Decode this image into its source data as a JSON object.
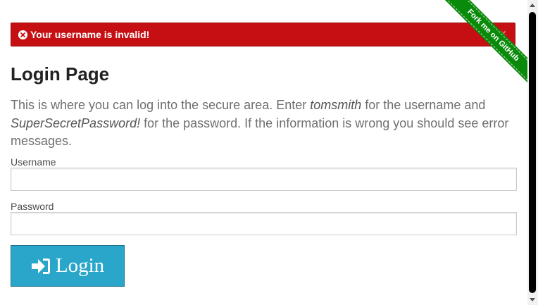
{
  "flash": {
    "message": "Your username is invalid!",
    "close_label": "×",
    "icon": "error-circle-icon",
    "color": "#c60f13"
  },
  "ribbon": {
    "label": "Fork me on GitHub",
    "color": "#0a8a0a"
  },
  "page": {
    "title": "Login Page",
    "description_part1": "This is where you can log into the secure area. Enter ",
    "username_hint": "tomsmith",
    "description_part2": " for the username and ",
    "password_hint": "SuperSecretPassword!",
    "description_part3": " for the password. If the information is wrong you should see error messages."
  },
  "form": {
    "username_label": "Username",
    "username_value": "",
    "password_label": "Password",
    "password_value": "",
    "login_label": "Login",
    "login_icon": "sign-in-icon",
    "button_color": "#2ba6cb"
  }
}
